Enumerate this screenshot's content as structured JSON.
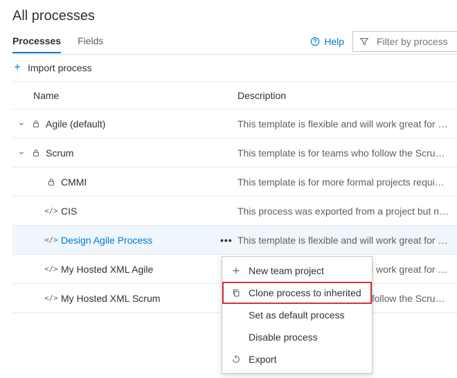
{
  "title": "All processes",
  "tabs": {
    "processes": "Processes",
    "fields": "Fields"
  },
  "toolbar": {
    "help": "Help",
    "filter_placeholder": "Filter by process na",
    "import": "Import process"
  },
  "columns": {
    "name": "Name",
    "description": "Description"
  },
  "rows": [
    {
      "name": "Agile (default)",
      "desc": "This template is flexible and will work great for …",
      "type": "lock",
      "expand": true,
      "indent": 0,
      "link": false
    },
    {
      "name": "Scrum",
      "desc": "This template is for teams who follow the Scru…",
      "type": "lock",
      "expand": true,
      "indent": 0,
      "link": false
    },
    {
      "name": "CMMI",
      "desc": "This template is for more formal projects requi…",
      "type": "lock",
      "expand": false,
      "indent": 1,
      "link": false
    },
    {
      "name": "CIS",
      "desc": "This process was exported from a project but n…",
      "type": "xml",
      "expand": false,
      "indent": 1,
      "link": false
    },
    {
      "name": "Design Agile Process",
      "desc": "This template is flexible and will work great for …",
      "type": "xml",
      "expand": false,
      "indent": 1,
      "link": true,
      "selected": true,
      "ellipsis": true
    },
    {
      "name": "My Hosted XML Agile",
      "desc": "This template is flexible and will work great for …",
      "type": "xml",
      "expand": false,
      "indent": 1,
      "link": false
    },
    {
      "name": "My Hosted XML Scrum",
      "desc": "This template is for teams who follow the Scru…",
      "type": "xml",
      "expand": false,
      "indent": 1,
      "link": false
    }
  ],
  "menu": {
    "new_project": "New team project",
    "clone": "Clone process to inherited",
    "set_default": "Set as default process",
    "disable": "Disable process",
    "export": "Export"
  }
}
